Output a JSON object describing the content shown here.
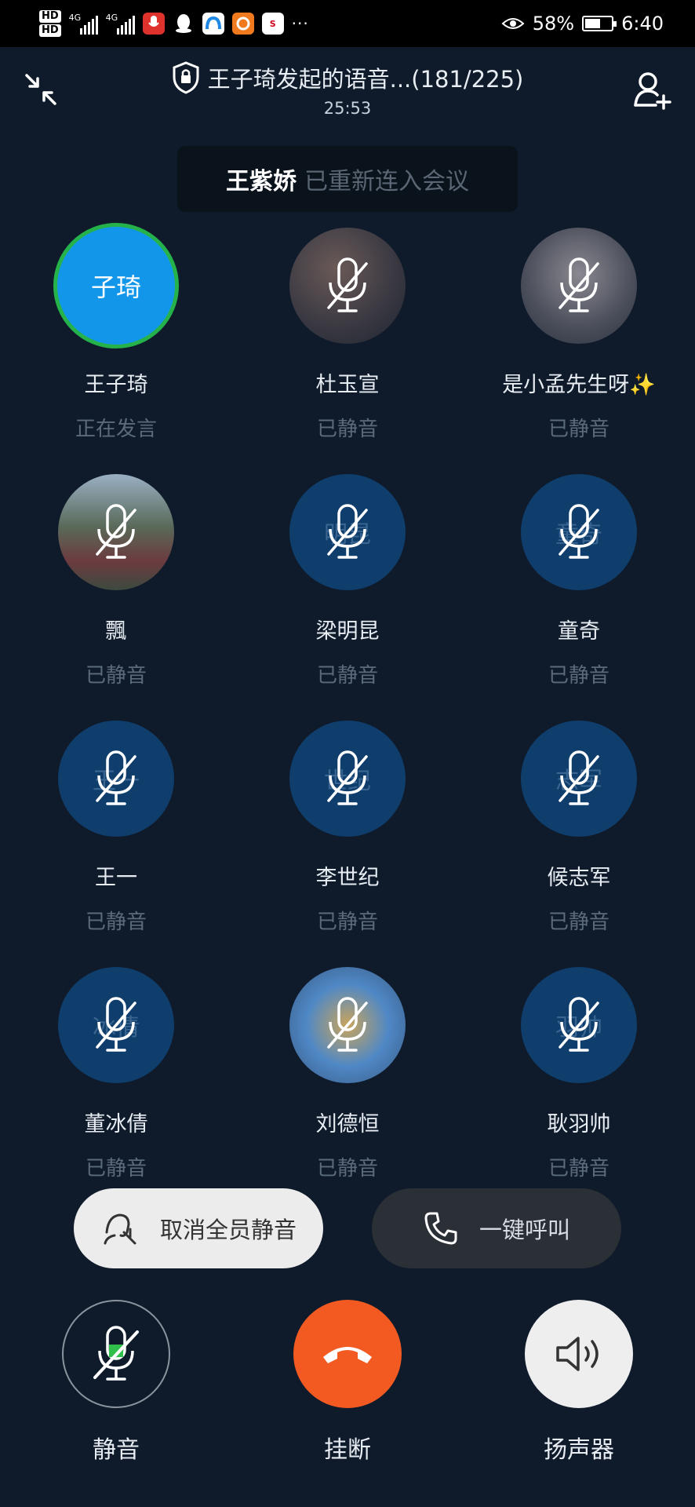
{
  "status_bar": {
    "hd1": "HD",
    "hd2": "HD",
    "net1": "4G",
    "net2": "4G",
    "battery_percent": "58%",
    "battery_level": 0.58,
    "time": "6:40",
    "overflow": "···",
    "app_icons": [
      "mic-app-icon",
      "qq-icon",
      "browser-icon",
      "uc-icon",
      "sina-icon"
    ]
  },
  "header": {
    "title": "王子琦发起的语音...(181/225)",
    "timer": "25:53"
  },
  "toast": {
    "name": "王紫娇",
    "message": "已重新连入会议"
  },
  "participants": [
    {
      "name": "王子琦",
      "status": "正在发言",
      "avatar_text": "子琦",
      "speaking": true,
      "photo": false,
      "muted": false
    },
    {
      "name": "杜玉宣",
      "status": "已静音",
      "avatar_text": "",
      "speaking": false,
      "photo": true,
      "muted": true
    },
    {
      "name": "是小孟先生呀✨",
      "status": "已静音",
      "avatar_text": "",
      "speaking": false,
      "photo": true,
      "muted": true
    },
    {
      "name": "飄",
      "status": "已静音",
      "avatar_text": "",
      "speaking": false,
      "photo": true,
      "muted": true
    },
    {
      "name": "梁明昆",
      "status": "已静音",
      "avatar_text": "明昆",
      "speaking": false,
      "photo": false,
      "muted": true
    },
    {
      "name": "童奇",
      "status": "已静音",
      "avatar_text": "童奇",
      "speaking": false,
      "photo": false,
      "muted": true
    },
    {
      "name": "王一",
      "status": "已静音",
      "avatar_text": "王一",
      "speaking": false,
      "photo": false,
      "muted": true
    },
    {
      "name": "李世纪",
      "status": "已静音",
      "avatar_text": "世纪",
      "speaking": false,
      "photo": false,
      "muted": true
    },
    {
      "name": "候志军",
      "status": "已静音",
      "avatar_text": "志军",
      "speaking": false,
      "photo": false,
      "muted": true
    },
    {
      "name": "董冰倩",
      "status": "已静音",
      "avatar_text": "冰倩",
      "speaking": false,
      "photo": false,
      "muted": true
    },
    {
      "name": "刘德恒",
      "status": "已静音",
      "avatar_text": "",
      "speaking": false,
      "photo": true,
      "muted": true
    },
    {
      "name": "耿羽帅",
      "status": "已静音",
      "avatar_text": "羽帅",
      "speaking": false,
      "photo": false,
      "muted": true
    }
  ],
  "actions": {
    "unmute_all": "取消全员静音",
    "call_all": "一键呼叫"
  },
  "controls": {
    "mute": "静音",
    "hangup": "挂断",
    "speaker": "扬声器"
  },
  "colors": {
    "background": "#0f1b2b",
    "avatar_blue": "#0f3e6d",
    "speaking_ring": "#25b24a",
    "speaking_fill": "#1296ea",
    "hangup": "#f25a22"
  }
}
